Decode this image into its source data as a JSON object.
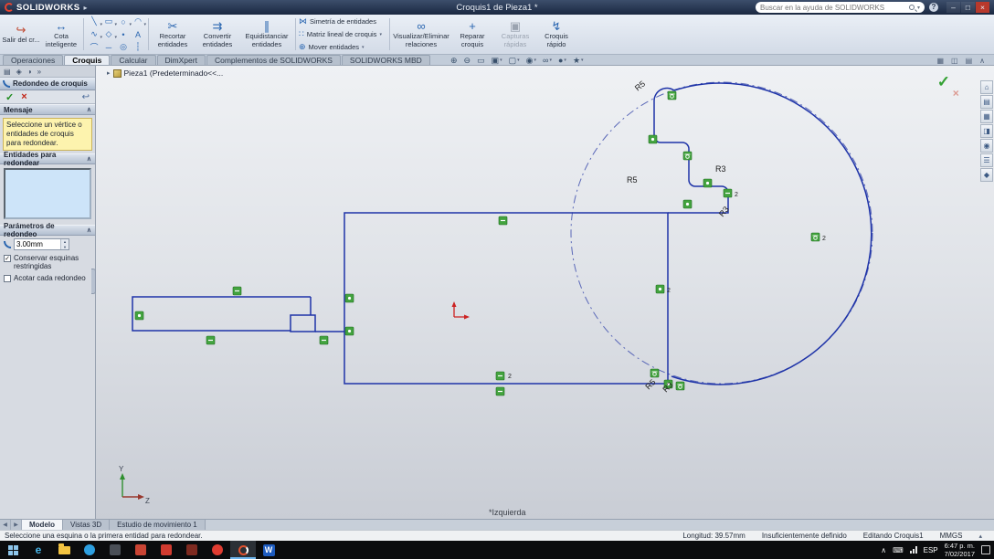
{
  "title_bar": {
    "logo": "SOLIDWORKS",
    "title": "Croquis1 de Pieza1 *",
    "search_placeholder": "Buscar en la ayuda de SOLIDWORKS"
  },
  "icons": {
    "menu_arrow": "▸",
    "window_minimize": "–",
    "window_maximize": "□",
    "window_close": "×",
    "help": "?",
    "dropdown": "▾",
    "exit_sketch": "↪",
    "smart_dimension": "↔",
    "entity_grid": [
      "╲",
      "▭",
      "○",
      "◠",
      "∿",
      "◇",
      "•",
      "A",
      "⌒",
      "─",
      "◎",
      "┆"
    ],
    "trim": "✂",
    "convert": "⇉",
    "offset": "∥",
    "mirror": "⋈",
    "linear_pattern": "∷",
    "move": "⊕",
    "relations": "∞",
    "repair": "+",
    "snapshots": "▣",
    "rapid": "↯",
    "pm_tabs": [
      "▤",
      "◈",
      "◑",
      "»"
    ],
    "pm_check": "✓",
    "pm_cancel": "×",
    "pm_back": "↩",
    "section_collapse": "∧",
    "spin_up": "▴",
    "spin_down": "▾",
    "checkbox_check": "✓",
    "hud": [
      "⊕",
      "⊖",
      "▭",
      "▣",
      "▢",
      "◉",
      "∞",
      "●",
      "★"
    ],
    "pane_controls": [
      "▦",
      "◫",
      "▤",
      "∧"
    ],
    "taskpane": [
      "⌂",
      "▤",
      "▦",
      "◨",
      "◉",
      "☰",
      "◆"
    ],
    "crumb_arrow": "▸",
    "confirm_check": "✓",
    "confirm_cancel": "×",
    "nav_prev": "◀",
    "nav_next": "▶",
    "status_toggle": "▴",
    "tray_chevron": "∧",
    "tray_keyboard": "⌨"
  },
  "ribbon": {
    "exit_sketch": "Salir del cr...",
    "smart_dimension": "Cota inteligente",
    "trim": "Recortar entidades",
    "convert": "Convertir entidades",
    "offset": "Equidistanciar entidades",
    "mirror": "Simetría de entidades",
    "linear_pattern": "Matriz lineal de croquis",
    "move": "Mover entidades",
    "relations": "Visualizar/Eliminar relaciones",
    "repair": "Reparar croquis",
    "snapshots": "Capturas rápidas",
    "rapid": "Croquis rápido"
  },
  "command_tabs": [
    {
      "label": "Operaciones"
    },
    {
      "label": "Croquis"
    },
    {
      "label": "Calcular"
    },
    {
      "label": "DimXpert"
    },
    {
      "label": "Complementos de SOLIDWORKS"
    },
    {
      "label": "SOLIDWORKS MBD"
    }
  ],
  "feature_tree": {
    "root": "Pieza1 (Predeterminado<<..."
  },
  "property_manager": {
    "title": "Redondeo de croquis",
    "message_header": "Mensaje",
    "message_text": "Seleccione un vértice o entidades de croquis para redondear.",
    "entities_header": "Entidades para redondear",
    "params_header": "Parámetros de redondeo",
    "radius_value": "3.00mm",
    "keep_corners_label": "Conservar esquinas restringidas",
    "dimension_each_label": "Acotar cada redondeo"
  },
  "graphics": {
    "view_label": "*Izquierda",
    "dim_labels": [
      "R5",
      "R5",
      "R3",
      "R3",
      "R5",
      "R3"
    ],
    "badge_count": "2",
    "triad": {
      "y": "Y",
      "z": "Z"
    }
  },
  "model_tabs": [
    {
      "label": "Modelo"
    },
    {
      "label": "Vistas 3D"
    },
    {
      "label": "Estudio de movimiento 1"
    }
  ],
  "status_bar": {
    "hint": "Seleccione una esquina o la primera entidad para redondear.",
    "length": "Longitud: 39.57mm",
    "definition": "Insuficientemente definido",
    "editing": "Editando Croquis1",
    "units": "MMGS"
  },
  "taskbar": {
    "edge_glyph": "e",
    "word_glyph": "W",
    "language": "ESP",
    "time": "6:47 p. m.",
    "date": "7/02/2017"
  }
}
